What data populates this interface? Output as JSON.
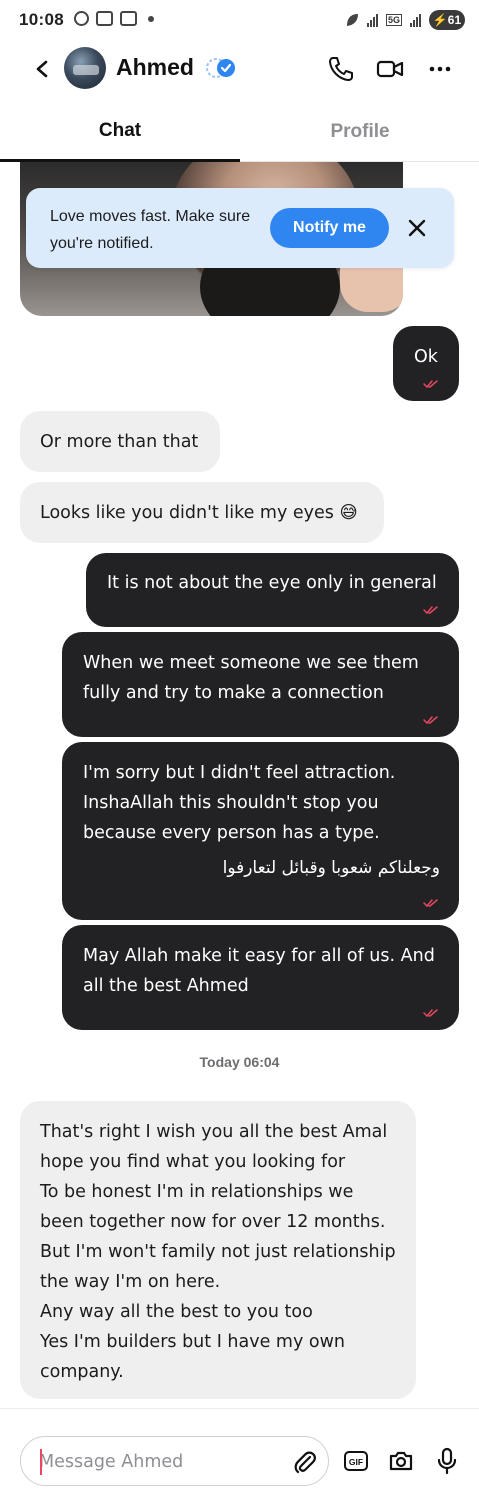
{
  "status_bar": {
    "time": "10:08",
    "network": "5G",
    "battery": "61"
  },
  "header": {
    "contact_name": "Ahmed"
  },
  "tabs": [
    {
      "label": "Chat"
    },
    {
      "label": "Profile"
    }
  ],
  "banner": {
    "text": "Love moves fast. Make sure you're notified.",
    "button": "Notify me"
  },
  "messages": [
    {
      "from": "me",
      "text": "Ok"
    },
    {
      "from": "them",
      "text": "Or more than that"
    },
    {
      "from": "them",
      "text": "Looks like you didn't like my eyes 😅"
    },
    {
      "from": "me",
      "text": "It is not about the eye only in general"
    },
    {
      "from": "me",
      "text": "When we meet someone we see them fully and try to make a connection"
    },
    {
      "from": "me",
      "text": "I'm sorry but I didn't feel attraction. InshaAllah this shouldn't stop you because every person has a type.",
      "text_arabic": "وجعلناكم شعوبا وقبائل لتعارفوا"
    },
    {
      "from": "me",
      "text": "May Allah make it easy for all of us. And all the best Ahmed"
    },
    {
      "from": "them",
      "text": "That's right I wish you all the best Amal hope you find what you looking for\nTo be honest I'm in relationships we been together now for over 12 months.\nBut I'm won't family not just relationship the way I'm on here.\nAny way all the best to you too\nYes I'm builders but I have my own company."
    }
  ],
  "timestamp": "Today 06:04",
  "composer": {
    "placeholder": "Message Ahmed"
  },
  "colors": {
    "accent": "#2f86f0",
    "outgoing_bubble": "#222224",
    "incoming_bubble": "#efefef",
    "read_tick": "#e8475f"
  }
}
